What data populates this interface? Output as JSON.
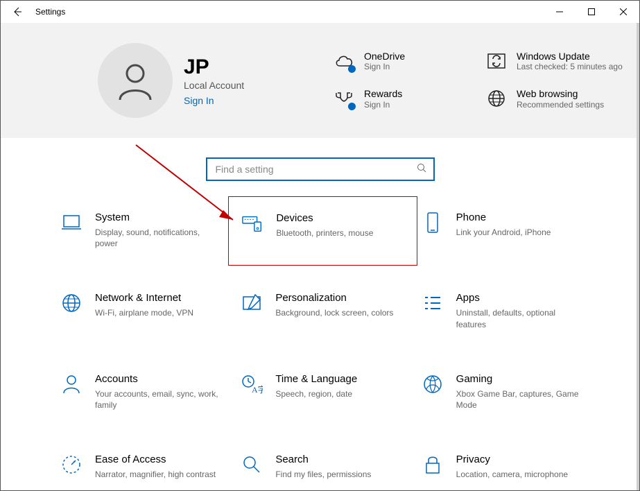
{
  "window": {
    "title": "Settings"
  },
  "account": {
    "name": "JP",
    "subtitle": "Local Account",
    "signin": "Sign In"
  },
  "status": {
    "onedrive": {
      "title": "OneDrive",
      "sub": "Sign In"
    },
    "rewards": {
      "title": "Rewards",
      "sub": "Sign In"
    },
    "update": {
      "title": "Windows Update",
      "sub": "Last checked: 5 minutes ago"
    },
    "browsing": {
      "title": "Web browsing",
      "sub": "Recommended settings"
    }
  },
  "search": {
    "placeholder": "Find a setting"
  },
  "tiles": {
    "system": {
      "title": "System",
      "sub": "Display, sound, notifications, power"
    },
    "devices": {
      "title": "Devices",
      "sub": "Bluetooth, printers, mouse"
    },
    "phone": {
      "title": "Phone",
      "sub": "Link your Android, iPhone"
    },
    "network": {
      "title": "Network & Internet",
      "sub": "Wi-Fi, airplane mode, VPN"
    },
    "personal": {
      "title": "Personalization",
      "sub": "Background, lock screen, colors"
    },
    "apps": {
      "title": "Apps",
      "sub": "Uninstall, defaults, optional features"
    },
    "accounts": {
      "title": "Accounts",
      "sub": "Your accounts, email, sync, work, family"
    },
    "time": {
      "title": "Time & Language",
      "sub": "Speech, region, date"
    },
    "gaming": {
      "title": "Gaming",
      "sub": "Xbox Game Bar, captures, Game Mode"
    },
    "ease": {
      "title": "Ease of Access",
      "sub": "Narrator, magnifier, high contrast"
    },
    "searcht": {
      "title": "Search",
      "sub": "Find my files, permissions"
    },
    "privacy": {
      "title": "Privacy",
      "sub": "Location, camera, microphone"
    }
  }
}
